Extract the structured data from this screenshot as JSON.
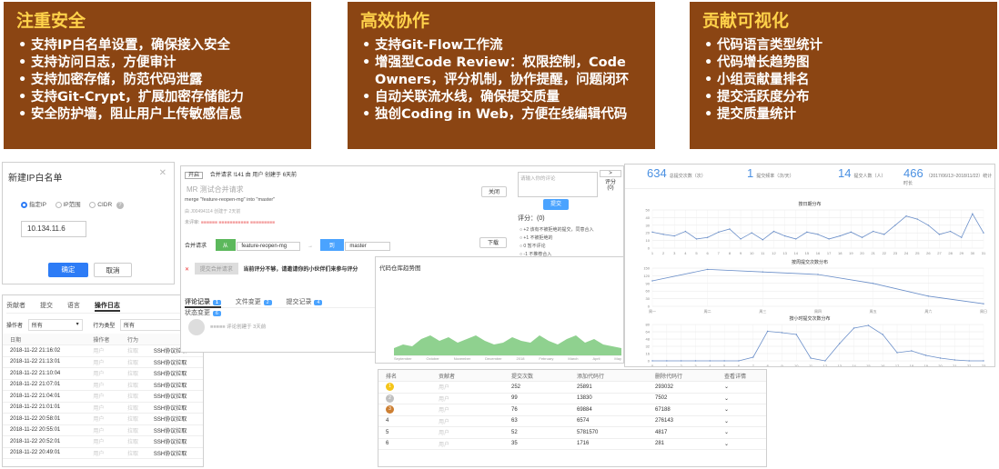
{
  "panels": [
    {
      "title": "注重安全",
      "items": [
        "支持IP白名单设置，确保接入安全",
        "支持访问日志，方便审计",
        "支持加密存储，防范代码泄露",
        "支持Git-Crypt，扩展加密存储能力",
        "安全防护墙，阻止用户上传敏感信息"
      ]
    },
    {
      "title": "高效协作",
      "items": [
        "支持Git-Flow工作流",
        "增强型Code Review：权限控制，Code Owners，评分机制，协作提醒，问题闭环",
        "自动关联流水线，确保提交质量",
        "独创Coding in Web，方便在线编辑代码"
      ]
    },
    {
      "title": "贡献可视化",
      "items": [
        "代码语言类型统计",
        "代码增长趋势图",
        "小组贡献量排名",
        "提交活跃度分布",
        "提交质量统计"
      ]
    }
  ],
  "ip_dialog": {
    "title": "新建IP白名单",
    "options": [
      "指定IP",
      "IP范围",
      "CIDR"
    ],
    "ip_value": "10.134.11.6",
    "confirm": "确定",
    "cancel": "取消"
  },
  "audit": {
    "tabs": [
      "贡献者",
      "提交",
      "语言",
      "操作日志"
    ],
    "filter_operator_label": "操作者",
    "filter_operator_value": "所有",
    "filter_type_label": "行为类型",
    "filter_type_value": "所有",
    "headers": [
      "日期",
      "操作者",
      "行为",
      ""
    ],
    "rows": [
      [
        "2018-11-22 21:16:02",
        "用户",
        "拉取",
        "SSH协议拉取"
      ],
      [
        "2018-11-22 21:13:01",
        "用户",
        "拉取",
        "SSH协议拉取"
      ],
      [
        "2018-11-22 21:10:04",
        "用户",
        "拉取",
        "SSH协议拉取"
      ],
      [
        "2018-11-22 21:07:01",
        "用户",
        "拉取",
        "SSH协议拉取"
      ],
      [
        "2018-11-22 21:04:01",
        "用户",
        "拉取",
        "SSH协议拉取"
      ],
      [
        "2018-11-22 21:01:01",
        "用户",
        "拉取",
        "SSH协议拉取"
      ],
      [
        "2018-11-22 20:58:01",
        "用户",
        "拉取",
        "SSH协议拉取"
      ],
      [
        "2018-11-22 20:55:01",
        "用户",
        "拉取",
        "SSH协议拉取"
      ],
      [
        "2018-11-22 20:52:01",
        "用户",
        "拉取",
        "SSH协议拉取"
      ],
      [
        "2018-11-22 20:49:01",
        "用户",
        "拉取",
        "SSH协议拉取"
      ]
    ]
  },
  "mr": {
    "status": "开启",
    "header": "合并请求 !141 由 用户 创建于 6天前",
    "title": "MR 测试合并请求",
    "close_btn": "关闭",
    "merge_desc": "merge \"feature-reopen-mg\" into \"master\"",
    "meta": "由 J00494114 创建于 2天前",
    "reviewers_label": "未评审:",
    "merge_request_label": "合并请求",
    "from_label": "从",
    "from_branch": "feature-reopen-mg",
    "to_label": "到",
    "to_branch": "master",
    "download_btn": "下载",
    "approve_btn": "提交合并请求",
    "warning": "当前评分不够，请邀请你的小伙伴们来参与评分",
    "tabs": [
      "评论记录",
      "文件变更",
      "提交记录",
      "状态变更"
    ],
    "tab_counts": [
      "1",
      "2",
      "4",
      "6"
    ],
    "comment_meta": "评论创建于 3天前",
    "comment_placeholder": "请输入你的评论",
    "submit_btn": "提交",
    "score_label": "评分：",
    "score_value": "(0)",
    "score_side_label": "评分",
    "score_side_value": "(0)",
    "score_options": [
      "+2 该有不被拒绝的提交，同意合入",
      "+1 不被拒绝的",
      "0 暂不评论",
      "-1 不推荐合入"
    ]
  },
  "trend": {
    "title": "代码仓库趋势图",
    "months": [
      "September",
      "October",
      "November",
      "December",
      "2018",
      "February",
      "March",
      "April",
      "May"
    ]
  },
  "ranking": {
    "headers": [
      "排名",
      "贡献者",
      "提交次数",
      "添加代码行",
      "删除代码行",
      "查看详情"
    ],
    "rows": [
      [
        "1",
        "用户",
        "252",
        "25891",
        "293032"
      ],
      [
        "2",
        "用户",
        "99",
        "13830",
        "7502"
      ],
      [
        "3",
        "用户",
        "76",
        "69884",
        "67188"
      ],
      [
        "4",
        "用户",
        "63",
        "6574",
        "276143"
      ],
      [
        "5",
        "用户",
        "52",
        "5781570",
        "4817"
      ],
      [
        "6",
        "用户",
        "35",
        "1716",
        "281"
      ]
    ],
    "medal_colors": [
      "#f5c518",
      "#c0c0c0",
      "#cd7f32"
    ]
  },
  "stats": [
    {
      "num": "634",
      "label": "总提交次数（次）"
    },
    {
      "num": "1",
      "label": "提交频率（次/天）"
    },
    {
      "num": "14",
      "label": "提交人数（人）"
    },
    {
      "num": "466",
      "label": "（2017/06/13~2018/11/22）统计时长"
    }
  ],
  "chart_data": [
    {
      "type": "line",
      "title": "按日期分布",
      "x": [
        1,
        2,
        3,
        4,
        5,
        6,
        7,
        8,
        9,
        10,
        11,
        12,
        13,
        14,
        15,
        16,
        17,
        18,
        19,
        20,
        21,
        22,
        23,
        24,
        25,
        26,
        27,
        28,
        29,
        30,
        31
      ],
      "values": [
        21,
        18,
        16,
        22,
        12,
        14,
        21,
        25,
        12,
        20,
        11,
        22,
        16,
        12,
        21,
        18,
        12,
        16,
        21,
        14,
        22,
        18,
        30,
        42,
        38,
        30,
        18,
        22,
        14,
        45,
        20
      ],
      "ylim": [
        0,
        50
      ]
    },
    {
      "type": "line",
      "title": "按周提交次数分布",
      "categories": [
        "周一",
        "周二",
        "周三",
        "周四",
        "周五",
        "周六",
        "周日"
      ],
      "values": [
        100,
        145,
        135,
        125,
        90,
        40,
        10
      ],
      "ylim": [
        0,
        150
      ]
    },
    {
      "type": "line",
      "title": "按小时提交次数分布",
      "x": [
        0,
        1,
        2,
        3,
        4,
        5,
        6,
        7,
        8,
        9,
        10,
        11,
        12,
        13,
        14,
        15,
        16,
        17,
        18,
        19,
        20,
        21,
        22,
        23
      ],
      "values": [
        0,
        0,
        0,
        0,
        0,
        0,
        0,
        8,
        65,
        62,
        58,
        6,
        0,
        38,
        72,
        78,
        58,
        18,
        22,
        12,
        6,
        2,
        0,
        0
      ],
      "ylim": [
        0,
        80
      ]
    }
  ]
}
